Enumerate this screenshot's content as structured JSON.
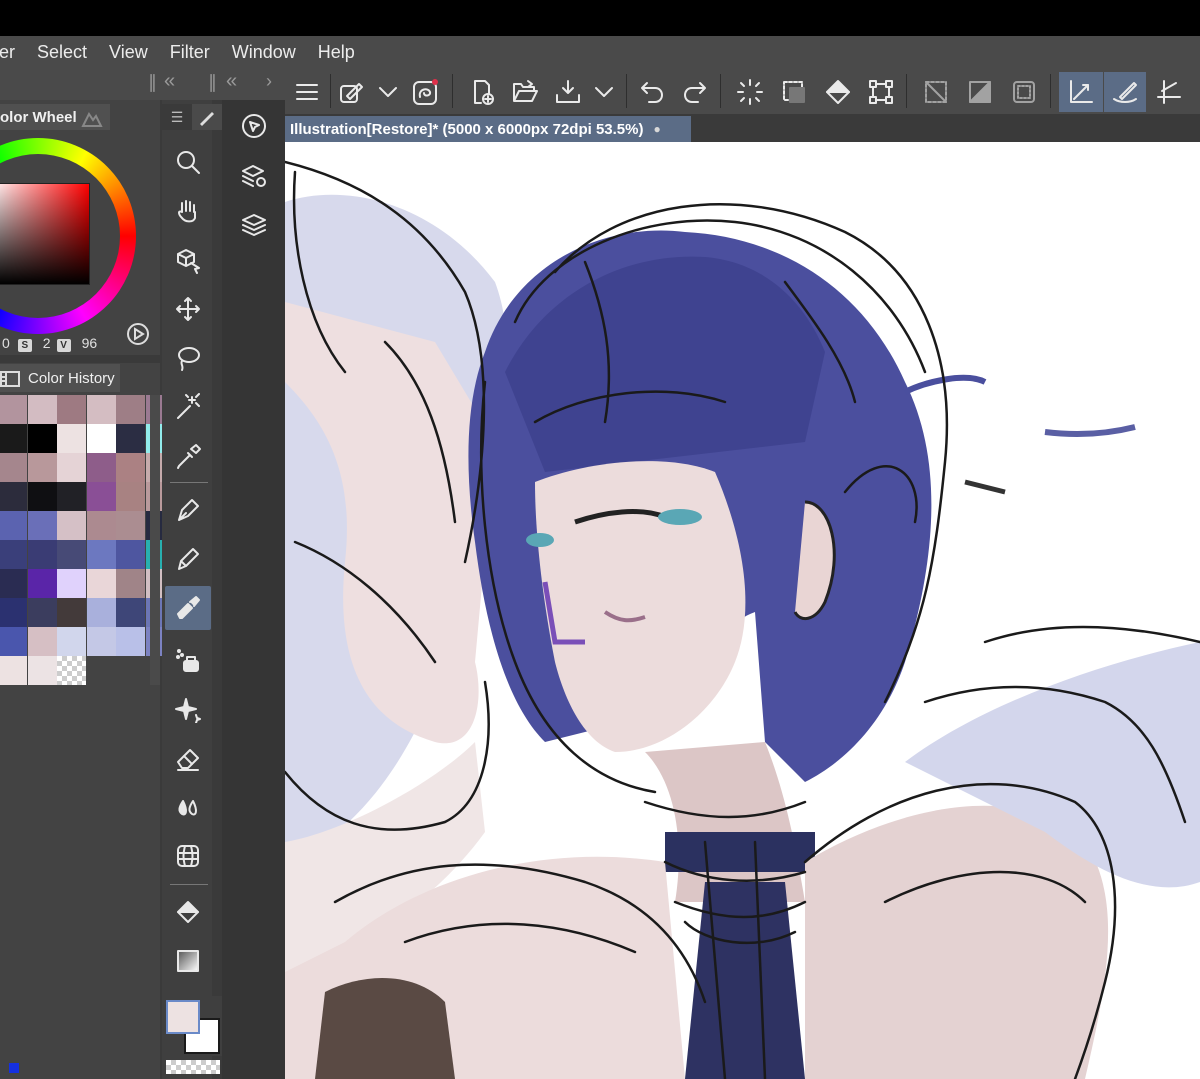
{
  "menu": [
    "er",
    "Select",
    "View",
    "Filter",
    "Window",
    "Help"
  ],
  "color_wheel": {
    "tab_label": "olor Wheel",
    "h_value": "0",
    "s_label": "S",
    "s_value": "2",
    "v_label": "V",
    "v_value": "96"
  },
  "color_history": {
    "tab_label": "Color History",
    "swatches": [
      [
        "#b2949e",
        "#d3bcc2",
        "#9e7a82",
        "#d4bdc2",
        "#9e7e86",
        "#9b7a92"
      ],
      [
        "#1a1a1a",
        "#000000",
        "#ede2e2",
        "#ffffff",
        "#2b2d43",
        "#92ecec"
      ],
      [
        "#a5868d",
        "#b8989b",
        "#e5d3d6",
        "#8e5d8a",
        "#ab8183",
        "#c6abac"
      ],
      [
        "#2c2c3c",
        "#0f0f12",
        "#212126",
        "#8a4f96",
        "#a88282",
        "#ba9a9c"
      ],
      [
        "#5b63b0",
        "#6a6fb8",
        "#d5c0c6",
        "#ac8a90",
        "#ab8d91",
        "#262a40"
      ],
      [
        "#3a3f7a",
        "#3a3c74",
        "#474a76",
        "#6c78c0",
        "#4e56a0",
        "#28b0b0"
      ],
      [
        "#2a2c52",
        "#5a25a8",
        "#e0d2fc",
        "#e9d6d8",
        "#a08488",
        "#d2bfc3"
      ],
      [
        "#2b3170",
        "#3b3d5e",
        "#433a3a",
        "#a9b0dc",
        "#3e4678",
        "#6c76b6"
      ],
      [
        "#4a56ad",
        "#d6bfc4",
        "#d1d6ec",
        "#c4c8e6",
        "#b9c0e8",
        "#7c82c2"
      ],
      [
        "#ede2e2",
        "#ece3e4",
        "checker",
        "",
        "",
        ""
      ]
    ]
  },
  "document_tab": {
    "title": "Illustration[Restore]* (5000 x 6000px 72dpi 53.5%)",
    "status": "●"
  },
  "colors": {
    "accent": "#5b6c86",
    "main_color": "#ede2e2",
    "sub_color": "#ffffff",
    "corner_indicator": "#1530e0"
  },
  "tools": [
    "zoom-tool",
    "hand-tool",
    "object-tool",
    "move-layer-tool",
    "lasso-selection-tool",
    "auto-select-tool",
    "eyedropper-tool",
    "pen-tool",
    "pencil-tool",
    "brush-tool",
    "airbrush-tool",
    "decoration-tool",
    "eraser-tool",
    "blend-tool",
    "figure-tool",
    "fill-tool",
    "gradient-tool"
  ],
  "command_icons": [
    "menu-icon",
    "edit-object-icon",
    "chevron-down-icon",
    "pressure-icon",
    "new-file-icon",
    "open-folder-icon",
    "save-icon",
    "chevron-down-icon",
    "undo-icon",
    "redo-icon",
    "loading-icon",
    "select-all-icon",
    "fill-icon",
    "transform-icon",
    "deselect-icon",
    "invert-selection-icon",
    "selection-border-icon",
    "ruler-snap-icon",
    "special-ruler-icon",
    "grid-snap-icon"
  ]
}
